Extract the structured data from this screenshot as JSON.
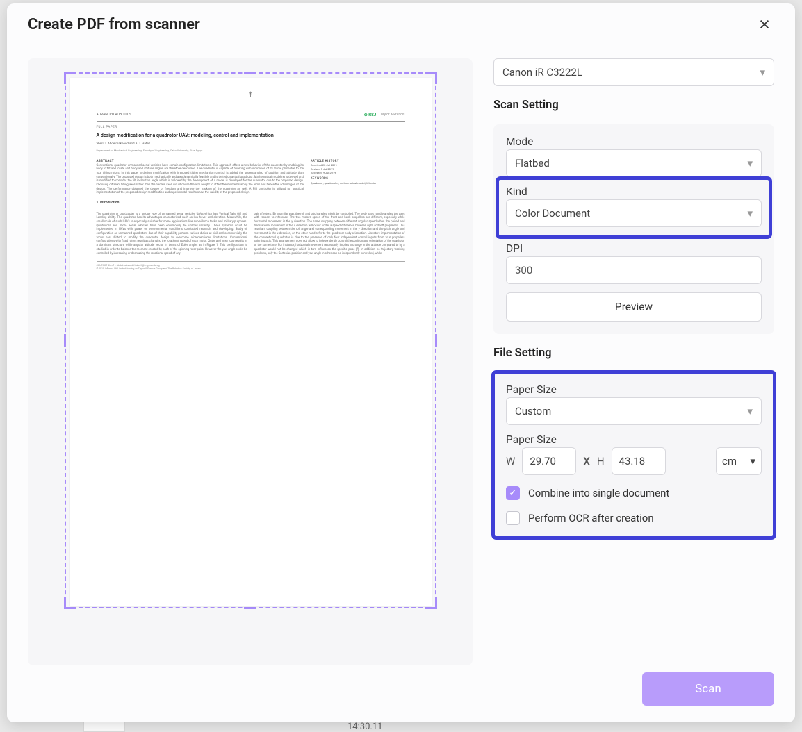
{
  "dialog": {
    "title": "Create PDF from scanner"
  },
  "scanner": {
    "selected": "Canon iR C3222L"
  },
  "scanSetting": {
    "title": "Scan Setting",
    "modeLabel": "Mode",
    "modeValue": "Flatbed",
    "kindLabel": "Kind",
    "kindValue": "Color Document",
    "dpiLabel": "DPI",
    "dpiValue": "300",
    "previewLabel": "Preview"
  },
  "fileSetting": {
    "title": "File Setting",
    "paperSizeLabel": "Paper Size",
    "paperSizeValue": "Custom",
    "dimLabel": "Paper Size",
    "wLabel": "W",
    "wValue": "29.70",
    "xLabel": "X",
    "hLabel": "H",
    "hValue": "43.18",
    "unit": "cm",
    "combineLabel": "Combine into single document",
    "combineChecked": true,
    "ocrLabel": "Perform OCR after creation",
    "ocrChecked": false
  },
  "footer": {
    "scanLabel": "Scan"
  },
  "preview": {
    "fullpaper": "FULL PAPER",
    "title": "A design modification for a quadrotor UAV: modeling, control and implementation",
    "authors": "Sherif I. Abdelmaksoud and A. T. Hafez",
    "affil": "Department of Mechanical Engineering, Faculty of Engineering, Cairo University, Giza, Egypt",
    "abstractLabel": "ABSTRACT",
    "articleHistory": "ARTICLE HISTORY",
    "introLabel": "1. Introduction",
    "rsj": "⊕ RSJ",
    "tf": "Taylor & Francis"
  },
  "behind": {
    "time": "14:30.11"
  }
}
